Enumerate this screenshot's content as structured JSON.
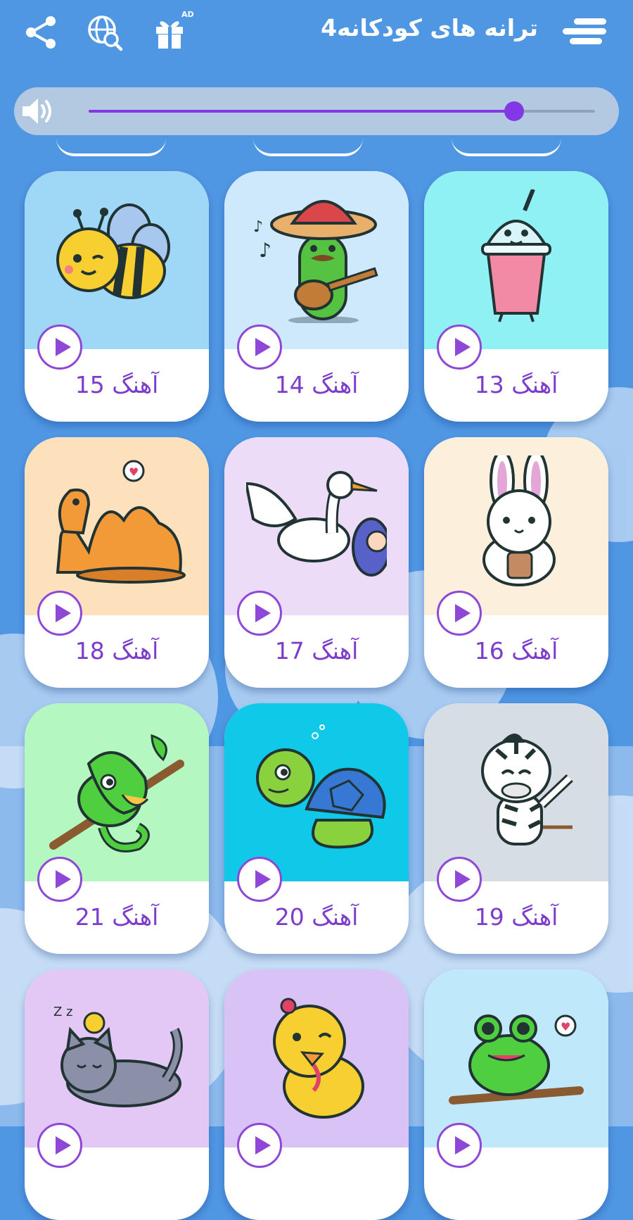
{
  "header": {
    "title": "ترانه های کودکانه4",
    "menu_icon": "menu-icon",
    "share_icon": "share-icon",
    "globe_icon": "globe-search-icon",
    "gift_icon": "gift-icon",
    "ad_badge": "AD"
  },
  "volume": {
    "icon": "speaker-icon",
    "level_fraction": 0.84,
    "color": "#8338e6"
  },
  "colors": {
    "background": "#4f96e3",
    "accent": "#8f47d8",
    "label": "#7c3ccc"
  },
  "songs": [
    {
      "label": "آهنگ 15",
      "illustration": "bee",
      "bg": "#9fd7f6"
    },
    {
      "label": "آهنگ 14",
      "illustration": "cactus-guitar",
      "bg": "#cde9fb"
    },
    {
      "label": "آهنگ 13",
      "illustration": "juice-cup",
      "bg": "#8ff1f4"
    },
    {
      "label": "آهنگ 18",
      "illustration": "camel",
      "bg": "#fde1bc"
    },
    {
      "label": "آهنگ 17",
      "illustration": "stork-baby",
      "bg": "#eddcf8"
    },
    {
      "label": "آهنگ 16",
      "illustration": "bunny",
      "bg": "#fcf0dc"
    },
    {
      "label": "آهنگ 21",
      "illustration": "chameleon",
      "bg": "#b5f7c1"
    },
    {
      "label": "آهنگ 20",
      "illustration": "turtle",
      "bg": "#10c9e8"
    },
    {
      "label": "آهنگ 19",
      "illustration": "zebra",
      "bg": "#d6dde4"
    },
    {
      "label": "",
      "illustration": "sleeping-cat",
      "bg": "#e3c8f6"
    },
    {
      "label": "",
      "illustration": "chick",
      "bg": "#d9c2f6"
    },
    {
      "label": "",
      "illustration": "frog",
      "bg": "#bfe8fa"
    }
  ]
}
